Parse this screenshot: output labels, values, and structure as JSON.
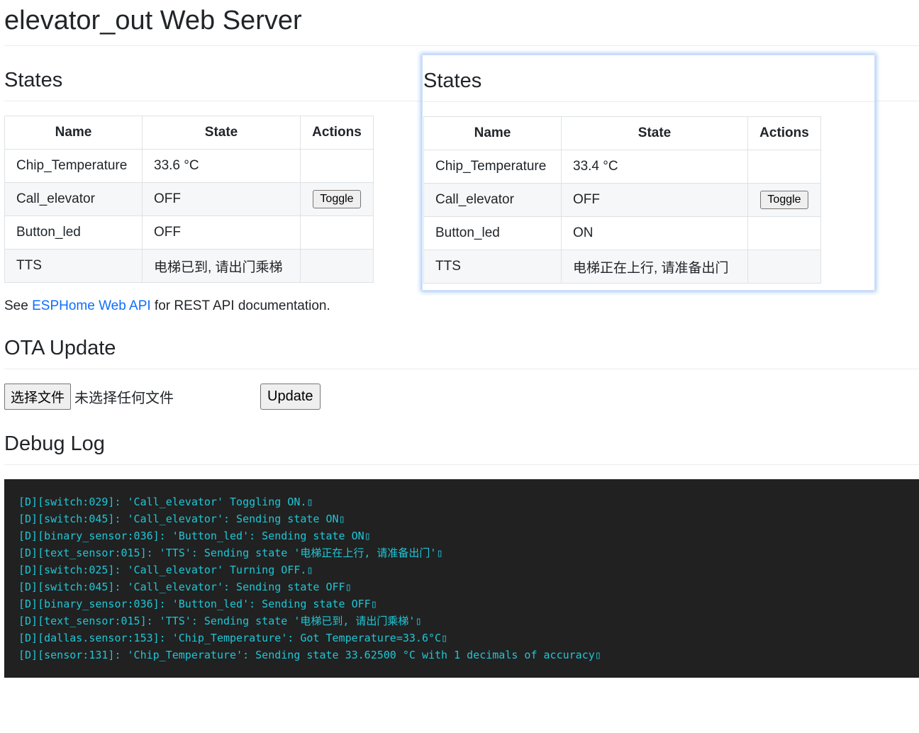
{
  "title": "elevator_out Web Server",
  "states_heading": "States",
  "columns": [
    "Name",
    "State",
    "Actions"
  ],
  "rows": [
    {
      "name": "Chip_Temperature",
      "state": "33.6 °C",
      "action": ""
    },
    {
      "name": "Call_elevator",
      "state": "OFF",
      "action": "Toggle"
    },
    {
      "name": "Button_led",
      "state": "OFF",
      "action": ""
    },
    {
      "name": "TTS",
      "state": "电梯已到, 请出门乘梯",
      "action": ""
    }
  ],
  "overlay": {
    "heading": "States",
    "rows": [
      {
        "name": "Chip_Temperature",
        "state": "33.4 °C",
        "action": ""
      },
      {
        "name": "Call_elevator",
        "state": "OFF",
        "action": "Toggle"
      },
      {
        "name": "Button_led",
        "state": "ON",
        "action": ""
      },
      {
        "name": "TTS",
        "state": "电梯正在上行, 请准备出门",
        "action": ""
      }
    ]
  },
  "api": {
    "pre": "See ",
    "link": "ESPHome Web API",
    "post": " for REST API documentation."
  },
  "ota": {
    "heading": "OTA Update",
    "choose": "选择文件",
    "no_file": "未选择任何文件",
    "update": "Update"
  },
  "debug": {
    "heading": "Debug Log",
    "lines": [
      "[D][switch:029]: 'Call_elevator' Toggling ON.▯",
      "[D][switch:045]: 'Call_elevator': Sending state ON▯",
      "[D][binary_sensor:036]: 'Button_led': Sending state ON▯",
      "[D][text_sensor:015]: 'TTS': Sending state '电梯正在上行, 请准备出门'▯",
      "[D][switch:025]: 'Call_elevator' Turning OFF.▯",
      "[D][switch:045]: 'Call_elevator': Sending state OFF▯",
      "[D][binary_sensor:036]: 'Button_led': Sending state OFF▯",
      "[D][text_sensor:015]: 'TTS': Sending state '电梯已到, 请出门乘梯'▯",
      "[D][dallas.sensor:153]: 'Chip_Temperature': Got Temperature=33.6°C▯",
      "[D][sensor:131]: 'Chip_Temperature': Sending state 33.62500 °C with 1 decimals of accuracy▯"
    ]
  }
}
